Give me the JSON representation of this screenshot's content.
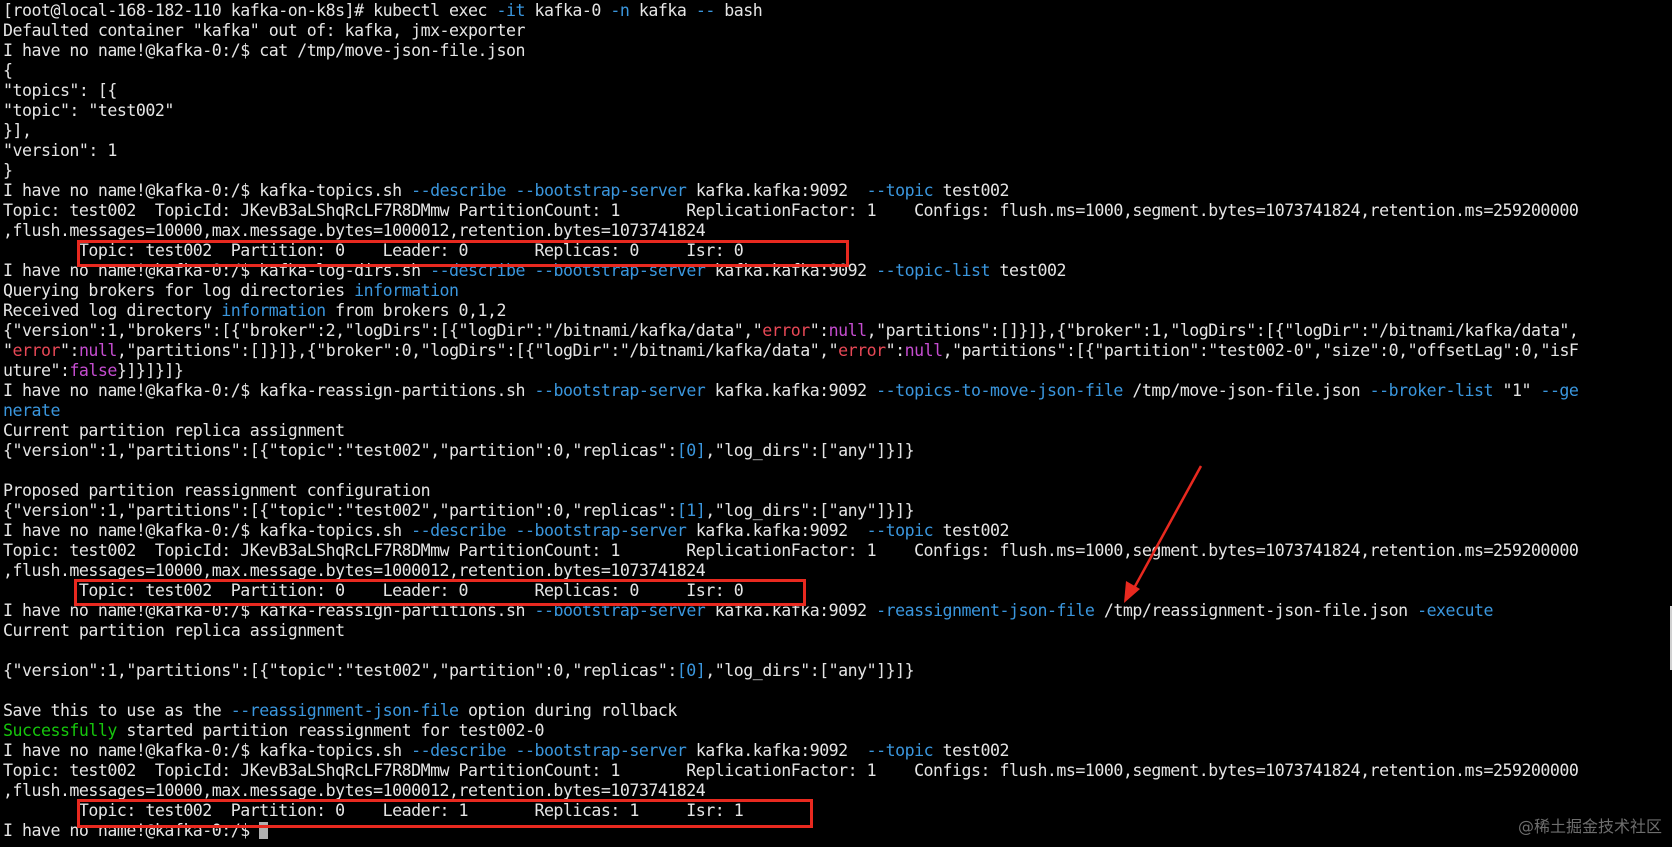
{
  "colors": {
    "background": "#000000",
    "text": "#e5e5e5",
    "flag": "#3a96dd",
    "keyword_red": "#e74856",
    "keyword_pink": "#c54dd0",
    "success_green": "#16c60c",
    "highlight_box": "#e8291f",
    "arrow": "#e8291f"
  },
  "terminal": {
    "lines": [
      [
        {
          "t": "[root@local-168-182-110 kafka-on-k8s]# kubectl exec ",
          "c": "default"
        },
        {
          "t": "-it",
          "c": "flag"
        },
        {
          "t": " kafka-0 ",
          "c": "default"
        },
        {
          "t": "-n",
          "c": "flag"
        },
        {
          "t": " kafka ",
          "c": "default"
        },
        {
          "t": "--",
          "c": "flag"
        },
        {
          "t": " bash",
          "c": "default"
        }
      ],
      [
        {
          "t": "Defaulted container \"kafka\" out of: kafka, jmx-exporter",
          "c": "default"
        }
      ],
      [
        {
          "t": "I have no name!@kafka-0:/$ cat /tmp/move-json-file.json",
          "c": "default"
        }
      ],
      [
        {
          "t": "{",
          "c": "default"
        }
      ],
      [
        {
          "t": "\"topics\": [{",
          "c": "default"
        }
      ],
      [
        {
          "t": "\"topic\": \"test002\"",
          "c": "default"
        }
      ],
      [
        {
          "t": "}],",
          "c": "default"
        }
      ],
      [
        {
          "t": "\"version\": 1",
          "c": "default"
        }
      ],
      [
        {
          "t": "}",
          "c": "default"
        }
      ],
      [
        {
          "t": "I have no name!@kafka-0:/$ kafka-topics.sh ",
          "c": "default"
        },
        {
          "t": "--describe",
          "c": "flag"
        },
        {
          "t": " ",
          "c": "default"
        },
        {
          "t": "--bootstrap-server",
          "c": "flag"
        },
        {
          "t": " kafka.kafka:9092  ",
          "c": "default"
        },
        {
          "t": "--topic",
          "c": "flag"
        },
        {
          "t": " test002",
          "c": "default"
        }
      ],
      [
        {
          "t": "Topic: test002  TopicId: JKevB3aLShqRcLF7R8DMmw PartitionCount: 1       ReplicationFactor: 1    Configs: flush.ms=1000,segment.bytes=1073741824,retention.ms=259200000",
          "c": "default"
        }
      ],
      [
        {
          "t": ",flush.messages=10000,max.message.bytes=1000012,retention.bytes=1073741824",
          "c": "default"
        }
      ],
      [
        {
          "t": "        Topic: test002  Partition: 0    Leader: 0       Replicas: 0     Isr: 0",
          "c": "default"
        }
      ],
      [
        {
          "t": "I have no name!@kafka-0:/$ kafka-log-dirs.sh ",
          "c": "default"
        },
        {
          "t": "--describe",
          "c": "flag"
        },
        {
          "t": " ",
          "c": "default"
        },
        {
          "t": "--bootstrap-server",
          "c": "flag"
        },
        {
          "t": " kafka.kafka:9092 ",
          "c": "default"
        },
        {
          "t": "--topic-list",
          "c": "flag"
        },
        {
          "t": " test002",
          "c": "default"
        }
      ],
      [
        {
          "t": "Querying brokers for log directories ",
          "c": "default"
        },
        {
          "t": "information",
          "c": "flag"
        }
      ],
      [
        {
          "t": "Received log directory ",
          "c": "default"
        },
        {
          "t": "information",
          "c": "flag"
        },
        {
          "t": " from brokers 0,1,2",
          "c": "default"
        }
      ],
      [
        {
          "t": "{\"version\":1,\"brokers\":[{\"broker\":2,\"logDirs\":[{\"logDir\":\"/bitnami/kafka/data\",\"",
          "c": "default"
        },
        {
          "t": "error",
          "c": "red"
        },
        {
          "t": "\":",
          "c": "default"
        },
        {
          "t": "null",
          "c": "pink"
        },
        {
          "t": ",\"partitions\":[]}]},{\"broker\":1,\"logDirs\":[{\"logDir\":\"/bitnami/kafka/data\",",
          "c": "default"
        }
      ],
      [
        {
          "t": "\"",
          "c": "default"
        },
        {
          "t": "error",
          "c": "red"
        },
        {
          "t": "\":",
          "c": "default"
        },
        {
          "t": "null",
          "c": "pink"
        },
        {
          "t": ",\"partitions\":[]}]},{\"broker\":0,\"logDirs\":[{\"logDir\":\"/bitnami/kafka/data\",\"",
          "c": "default"
        },
        {
          "t": "error",
          "c": "red"
        },
        {
          "t": "\":",
          "c": "default"
        },
        {
          "t": "null",
          "c": "pink"
        },
        {
          "t": ",\"partitions\":[{\"partition\":\"test002-0\",\"size\":0,\"offsetLag\":0,\"isF",
          "c": "default"
        }
      ],
      [
        {
          "t": "uture\":",
          "c": "default"
        },
        {
          "t": "false",
          "c": "pink"
        },
        {
          "t": "}]}]}]}",
          "c": "default"
        }
      ],
      [
        {
          "t": "I have no name!@kafka-0:/$ kafka-reassign-partitions.sh ",
          "c": "default"
        },
        {
          "t": "--bootstrap-server",
          "c": "flag"
        },
        {
          "t": " kafka.kafka:9092 ",
          "c": "default"
        },
        {
          "t": "--topics-to-move-json-file",
          "c": "flag"
        },
        {
          "t": " /tmp/move-json-file.json ",
          "c": "default"
        },
        {
          "t": "--broker-list",
          "c": "flag"
        },
        {
          "t": " \"1\" ",
          "c": "default"
        },
        {
          "t": "--ge",
          "c": "flag"
        }
      ],
      [
        {
          "t": "nerate",
          "c": "flag"
        }
      ],
      [
        {
          "t": "Current partition replica assignment",
          "c": "default"
        }
      ],
      [
        {
          "t": "{\"version\":1,\"partitions\":[{\"topic\":\"test002\",\"partition\":0,\"replicas\":",
          "c": "default"
        },
        {
          "t": "[0]",
          "c": "flag"
        },
        {
          "t": ",\"log_dirs\":[\"any\"]}]}",
          "c": "default"
        }
      ],
      [],
      [
        {
          "t": "Proposed partition reassignment configuration",
          "c": "default"
        }
      ],
      [
        {
          "t": "{\"version\":1,\"partitions\":[{\"topic\":\"test002\",\"partition\":0,\"replicas\":",
          "c": "default"
        },
        {
          "t": "[1]",
          "c": "flag"
        },
        {
          "t": ",\"log_dirs\":[\"any\"]}]}",
          "c": "default"
        }
      ],
      [
        {
          "t": "I have no name!@kafka-0:/$ kafka-topics.sh ",
          "c": "default"
        },
        {
          "t": "--describe",
          "c": "flag"
        },
        {
          "t": " ",
          "c": "default"
        },
        {
          "t": "--bootstrap-server",
          "c": "flag"
        },
        {
          "t": " kafka.kafka:9092  ",
          "c": "default"
        },
        {
          "t": "--topic",
          "c": "flag"
        },
        {
          "t": " test002",
          "c": "default"
        }
      ],
      [
        {
          "t": "Topic: test002  TopicId: JKevB3aLShqRcLF7R8DMmw PartitionCount: 1       ReplicationFactor: 1    Configs: flush.ms=1000,segment.bytes=1073741824,retention.ms=259200000",
          "c": "default"
        }
      ],
      [
        {
          "t": ",flush.messages=10000,max.message.bytes=1000012,retention.bytes=1073741824",
          "c": "default"
        }
      ],
      [
        {
          "t": "        Topic: test002  Partition: 0    Leader: 0       Replicas: 0     Isr: 0",
          "c": "default"
        }
      ],
      [
        {
          "t": "I have no name!@kafka-0:/$ kafka-reassign-partitions.sh ",
          "c": "default"
        },
        {
          "t": "--bootstrap-server",
          "c": "flag"
        },
        {
          "t": " kafka.kafka:9092 ",
          "c": "default"
        },
        {
          "t": "-reassignment-json-file",
          "c": "flag"
        },
        {
          "t": " /tmp/reassignment-json-file.json ",
          "c": "default"
        },
        {
          "t": "-execute",
          "c": "flag"
        }
      ],
      [
        {
          "t": "Current partition replica assignment",
          "c": "default"
        }
      ],
      [],
      [
        {
          "t": "{\"version\":1,\"partitions\":[{\"topic\":\"test002\",\"partition\":0,\"replicas\":",
          "c": "default"
        },
        {
          "t": "[0]",
          "c": "flag"
        },
        {
          "t": ",\"log_dirs\":[\"any\"]}]}",
          "c": "default"
        }
      ],
      [],
      [
        {
          "t": "Save this to use as the ",
          "c": "default"
        },
        {
          "t": "--reassignment-json-file",
          "c": "flag"
        },
        {
          "t": " option during rollback",
          "c": "default"
        }
      ],
      [
        {
          "t": "Successfully",
          "c": "green"
        },
        {
          "t": " started partition reassignment for test002-0",
          "c": "default"
        }
      ],
      [
        {
          "t": "I have no name!@kafka-0:/$ kafka-topics.sh ",
          "c": "default"
        },
        {
          "t": "--describe",
          "c": "flag"
        },
        {
          "t": " ",
          "c": "default"
        },
        {
          "t": "--bootstrap-server",
          "c": "flag"
        },
        {
          "t": " kafka.kafka:9092  ",
          "c": "default"
        },
        {
          "t": "--topic",
          "c": "flag"
        },
        {
          "t": " test002",
          "c": "default"
        }
      ],
      [
        {
          "t": "Topic: test002  TopicId: JKevB3aLShqRcLF7R8DMmw PartitionCount: 1       ReplicationFactor: 1    Configs: flush.ms=1000,segment.bytes=1073741824,retention.ms=259200000",
          "c": "default"
        }
      ],
      [
        {
          "t": ",flush.messages=10000,max.message.bytes=1000012,retention.bytes=1073741824",
          "c": "default"
        }
      ],
      [
        {
          "t": "        Topic: test002  Partition: 0    Leader: 1       Replicas: 1     Isr: 1",
          "c": "default"
        }
      ],
      [
        {
          "t": "I have no name!@kafka-0:/$ ",
          "c": "default"
        }
      ]
    ],
    "cursor_line": 41
  },
  "watermark": "@稀土掘金技术社区"
}
